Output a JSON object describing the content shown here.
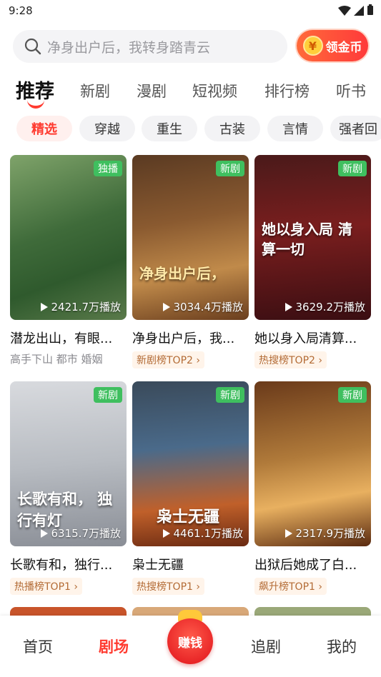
{
  "status_bar": {
    "time": "9:28"
  },
  "search": {
    "placeholder": "净身出户后，我转身踏青云",
    "coin_button": "领金币",
    "coin_symbol": "¥"
  },
  "top_tabs": [
    "推荐",
    "新剧",
    "漫剧",
    "短视频",
    "排行榜",
    "听书"
  ],
  "chips": [
    "精选",
    "穿越",
    "重生",
    "古装",
    "言情",
    "强者回"
  ],
  "cards": [
    {
      "tag": "独播",
      "plays": "2421.7万播放",
      "title": "潜龙出山，有眼...",
      "subtitle": "高手下山 都市 婚姻",
      "badge": ""
    },
    {
      "tag": "新剧",
      "plays": "3034.4万播放",
      "title": "净身出户后，我...",
      "subtitle": "",
      "badge": "新剧榜TOP2",
      "poster_text": "净身出户后，"
    },
    {
      "tag": "新剧",
      "plays": "3629.2万播放",
      "title": "她以身入局清算...",
      "subtitle": "",
      "badge": "热搜榜TOP2",
      "poster_text": "她以身入局 清算一切"
    },
    {
      "tag": "新剧",
      "plays": "6315.7万播放",
      "title": "长歌有和，独行...",
      "subtitle": "",
      "badge": "热播榜TOP1",
      "poster_text": "长歌有和， 独行有灯"
    },
    {
      "tag": "新剧",
      "plays": "4461.1万播放",
      "title": "枭士无疆",
      "subtitle": "",
      "badge": "热搜榜TOP1",
      "poster_text": "枭士无疆"
    },
    {
      "tag": "新剧",
      "plays": "2317.9万播放",
      "title": "出狱后她成了白...",
      "subtitle": "",
      "badge": "飙升榜TOP1"
    }
  ],
  "bottom_nav": {
    "items": [
      "首页",
      "剧场",
      "追剧",
      "我的"
    ],
    "center": "赚钱"
  },
  "colors": {
    "accent": "#ff3b30",
    "tag_green": "#3fbf5f"
  }
}
